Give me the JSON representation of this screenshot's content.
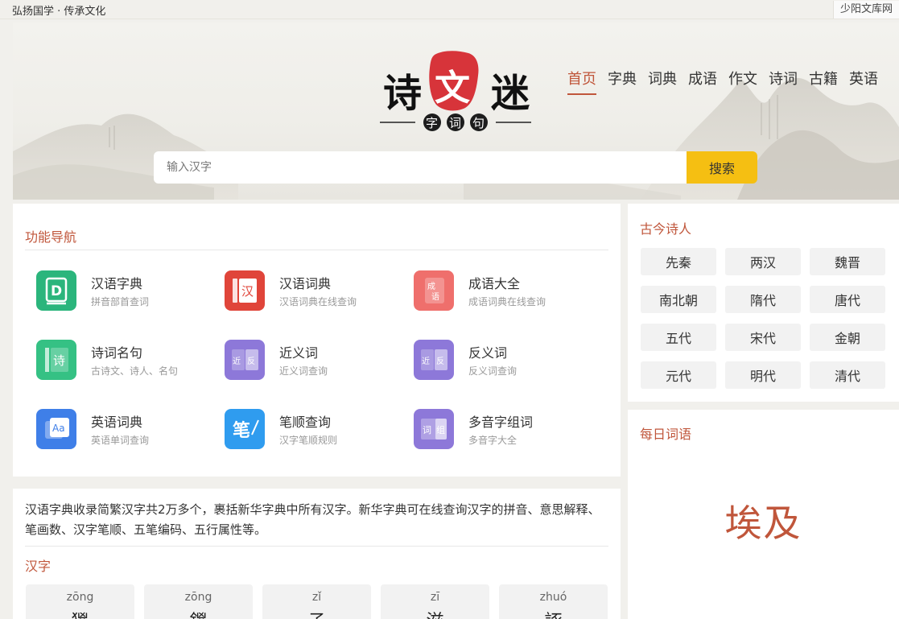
{
  "topbar": {
    "slogan": "弘扬国学 · 传承文化",
    "site": "少阳文库网"
  },
  "nav": {
    "items": [
      "首页",
      "字典",
      "词典",
      "成语",
      "作文",
      "诗词",
      "古籍",
      "英语"
    ],
    "active": "首页"
  },
  "logo": {
    "text": "诗文迷",
    "subtitle": "字词句"
  },
  "search": {
    "placeholder": "输入汉字",
    "button": "搜索"
  },
  "features": {
    "title": "功能导航",
    "items": [
      {
        "title": "汉语字典",
        "desc": "拼音部首查词",
        "icon": "dictionary-d-icon",
        "color": "#2bb57c",
        "glyph": "D"
      },
      {
        "title": "汉语词典",
        "desc": "汉语词典在线查询",
        "icon": "han-book-icon",
        "color": "#e0453a",
        "glyph": "汉"
      },
      {
        "title": "成语大全",
        "desc": "成语词典在线查询",
        "icon": "idiom-book-icon",
        "color": "#ef6f6c",
        "glyph": "成语"
      },
      {
        "title": "诗词名句",
        "desc": "古诗文、诗人、名句",
        "icon": "poetry-book-icon",
        "color": "#35c184",
        "glyph": "诗"
      },
      {
        "title": "近义词",
        "desc": "近义词查询",
        "icon": "synonym-icon",
        "color": "#8d78d9",
        "glyph": "近|反"
      },
      {
        "title": "反义词",
        "desc": "反义词查询",
        "icon": "antonym-icon",
        "color": "#8d78d9",
        "glyph": "近|反"
      },
      {
        "title": "英语词典",
        "desc": "英语单词查询",
        "icon": "english-aa-icon",
        "color": "#3f7fe8",
        "glyph": "Aa"
      },
      {
        "title": "笔顺查询",
        "desc": "汉字笔顺规则",
        "icon": "stroke-pen-icon",
        "color": "#2f9cef",
        "glyph": "笔"
      },
      {
        "title": "多音字组词",
        "desc": "多音字大全",
        "icon": "polyphone-book-icon",
        "color": "#8d78d9",
        "glyph": "词组"
      }
    ]
  },
  "intro": {
    "desc": "汉语字典收录简繁汉字共2万多个，裹括新华字典中所有汉字。新华字典可在线查询汉字的拼音、意思解释、笔画数、汉字笔顺、五笔编码、五行属性等。",
    "chars_title": "汉字",
    "chars": [
      {
        "pinyin": "zōng",
        "char": "猣"
      },
      {
        "pinyin": "zōng",
        "char": "鍐"
      },
      {
        "pinyin": "zǐ",
        "char": "子"
      },
      {
        "pinyin": "zī",
        "char": "滋"
      },
      {
        "pinyin": "zhuó",
        "char": "諑"
      }
    ]
  },
  "poets": {
    "title": "古今诗人",
    "eras": [
      "先秦",
      "两汉",
      "魏晋",
      "南北朝",
      "隋代",
      "唐代",
      "五代",
      "宋代",
      "金朝",
      "元代",
      "明代",
      "清代"
    ]
  },
  "daily": {
    "title": "每日词语",
    "word": "埃及"
  },
  "colors": {
    "accent": "#c0563b",
    "search_button": "#f5bf12"
  }
}
